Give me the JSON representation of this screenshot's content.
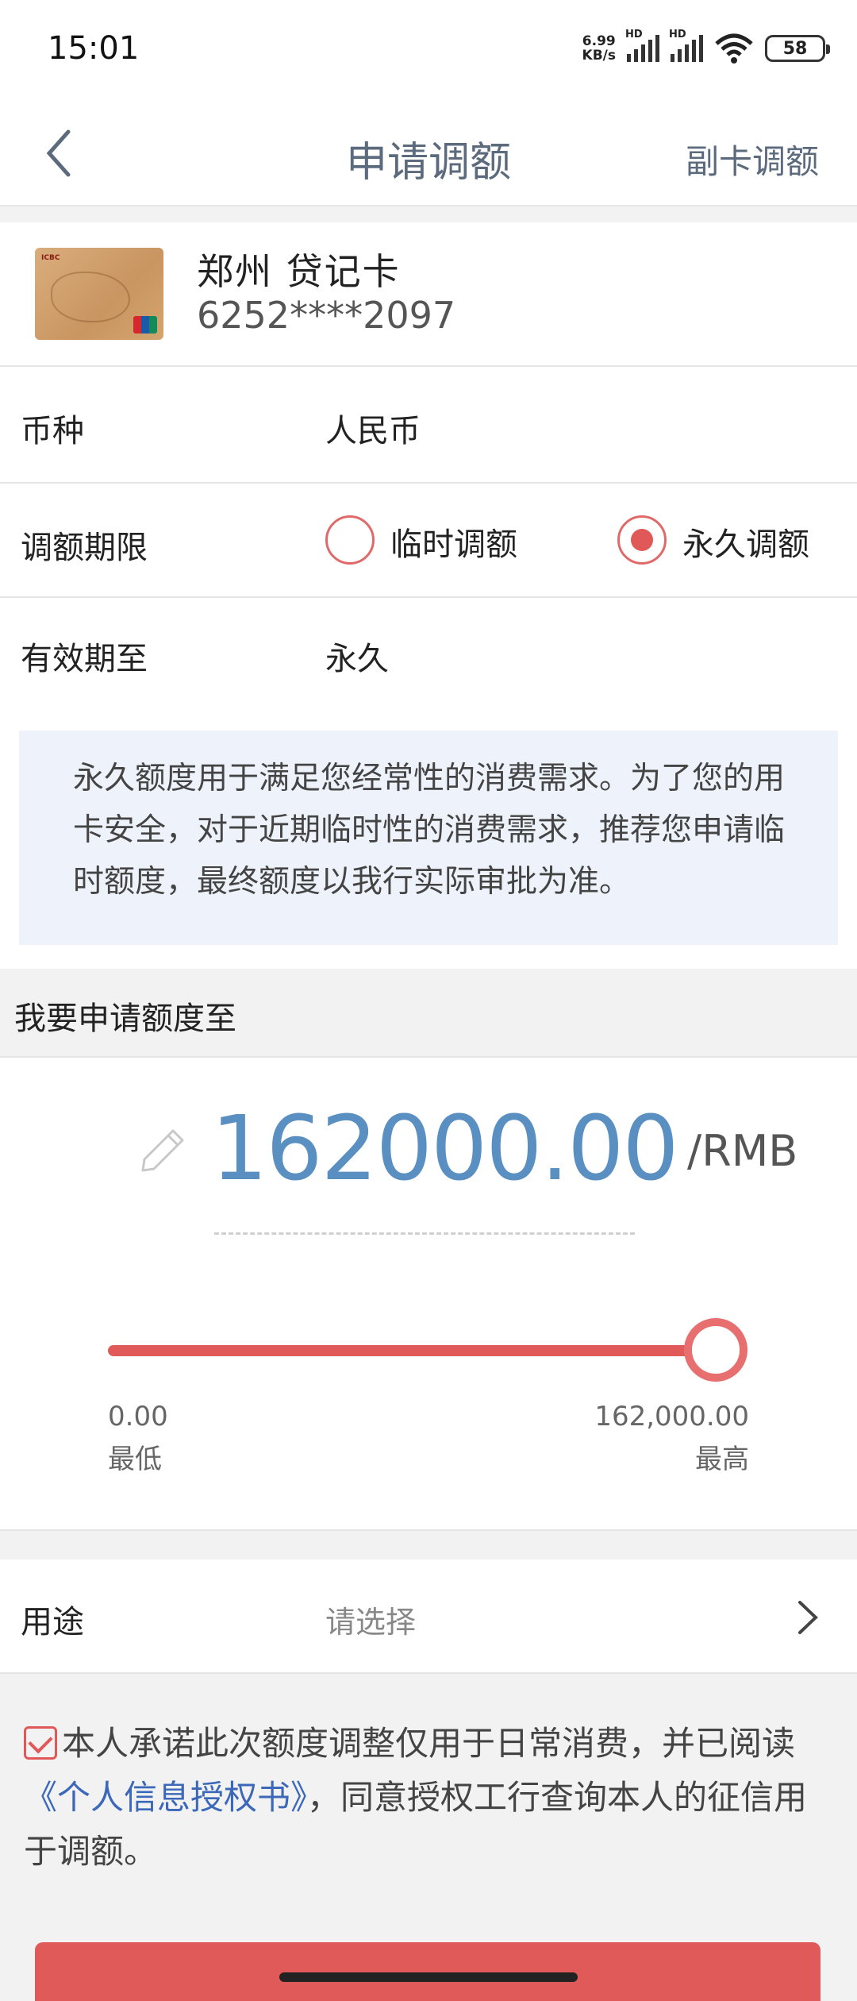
{
  "status_bar": {
    "time": "15:01",
    "net_speed_value": "6.99",
    "net_speed_unit": "KB/s",
    "signal_label_1": "HD",
    "signal_label_2": "HD",
    "battery": "58"
  },
  "header": {
    "title": "申请调额",
    "right_action": "副卡调额",
    "back_icon": "chevron-left-icon"
  },
  "card": {
    "name": "郑州  贷记卡",
    "number": "6252****2097"
  },
  "form": {
    "currency_label": "币种",
    "currency_value": "人民币",
    "period_label": "调额期限",
    "option_temporary": "临时调额",
    "option_permanent": "永久调额",
    "selected_option": "永久调额",
    "valid_until_label": "有效期至",
    "valid_until_value": "永久"
  },
  "notice": "永久额度用于满足您经常性的消费需求。为了您的用卡安全，对于近期临时性的消费需求，推荐您申请临时额度，最终额度以我行实际审批为准。",
  "amount": {
    "section_label": "我要申请额度至",
    "value": "162000.00",
    "unit": "/RMB",
    "slider_fraction": 1.0,
    "min_value": "0.00",
    "min_label": "最低",
    "max_value": "162,000.00",
    "max_label": "最高"
  },
  "purpose": {
    "label": "用途",
    "placeholder": "请选择"
  },
  "agreement": {
    "checked": true,
    "text_before": "本人承诺此次额度调整仅用于日常消费，并已阅读",
    "link_text": "《个人信息授权书》",
    "text_after": "，同意授权工行查询本人的征信用于调额。"
  },
  "colors": {
    "accent": "#e05a5a",
    "amount": "#5a8fc2",
    "link": "#3b68b8",
    "title": "#5b6b7d"
  }
}
